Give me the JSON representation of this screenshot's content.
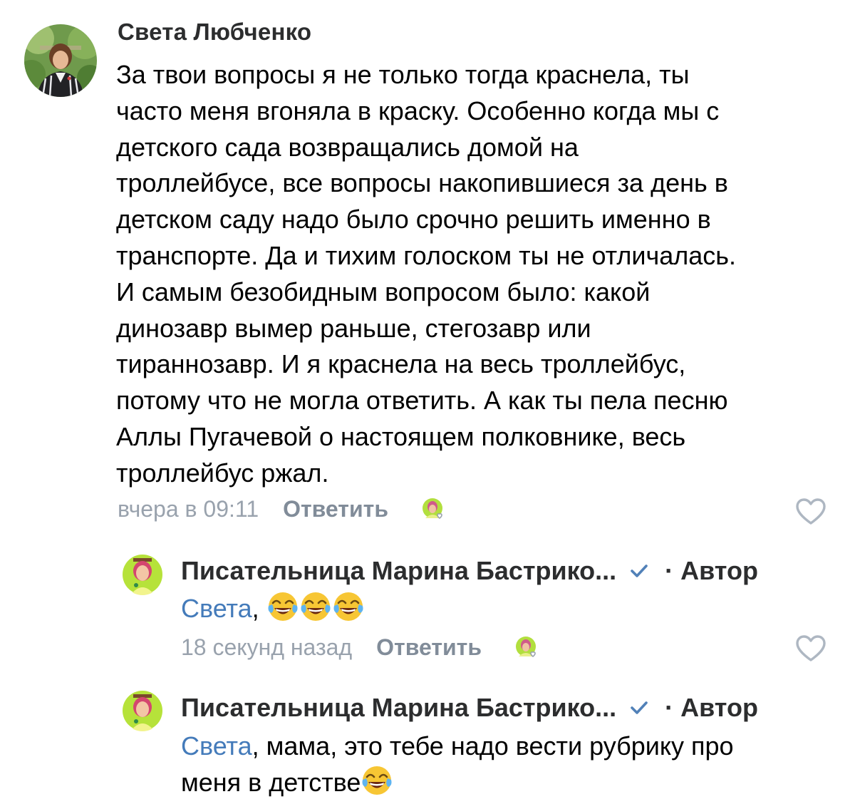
{
  "comment": {
    "author": "Света Любченко",
    "lines": [
      "За твои вопросы я не только тогда краснела, ты",
      "часто меня вгоняла в краску. Особенно когда мы с",
      "детского сада возвращались домой на",
      "троллейбусе, все вопросы накопившиеся за день в",
      "детском саду надо было срочно решить именно в",
      "транспорте. Да и тихим голоском ты не отличалась.",
      "И самым безобидным вопросом было: какой",
      "динозавр вымер раньше, стегозавр или",
      "тираннозавр. И я краснела на весь троллейбус,",
      "потому что не могла ответить. А как ты пела песню",
      "Аллы Пугачевой о настоящем полковнике, весь",
      "троллейбус ржал."
    ],
    "time": "вчера в 09:11",
    "reply_label": "Ответить"
  },
  "replies": [
    {
      "author": "Писательница Марина Бастрико...",
      "author_tag": "· Автор",
      "mention": "Света",
      "text_after_mention": ", ",
      "emojis": [
        "tears-of-joy-emoji",
        "tears-of-joy-emoji",
        "tears-of-joy-emoji"
      ],
      "time": "18 секунд назад",
      "reply_label": "Ответить"
    },
    {
      "author": "Писательница Марина Бастрико...",
      "author_tag": "· Автор",
      "mention": "Света",
      "line1_after_mention": ", мама, это тебе надо вести рубрику про",
      "line2": "меня в детстве",
      "emojis": [
        "tears-of-joy-emoji"
      ]
    }
  ],
  "colors": {
    "name": "#2c2d2e",
    "meta": "#99a2ad",
    "reply_button": "#818c99",
    "mention": "#447bba",
    "verified": "#5181b8",
    "heart": "#aeb7c2"
  }
}
